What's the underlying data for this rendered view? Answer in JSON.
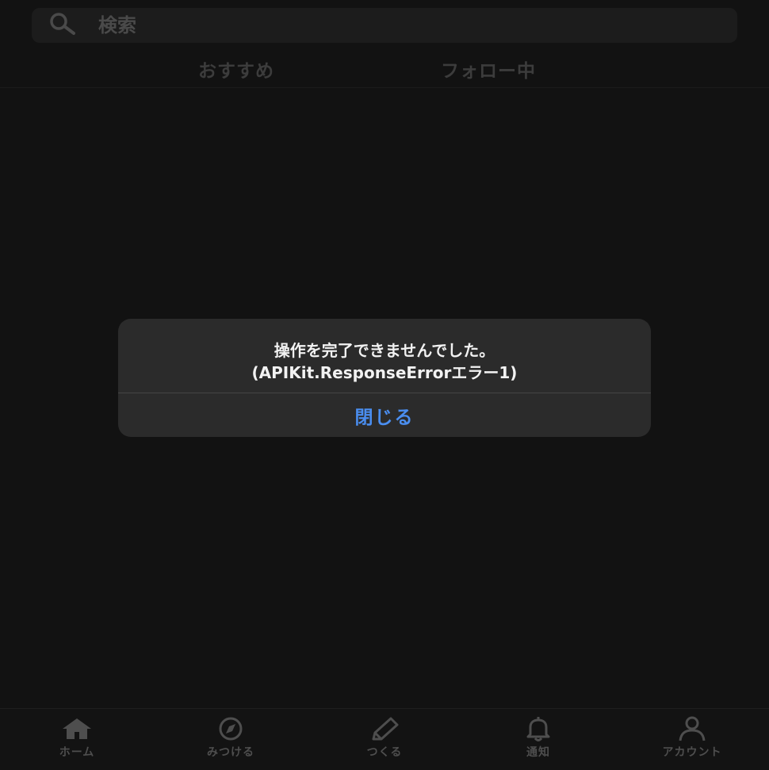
{
  "search": {
    "placeholder": "検索"
  },
  "tabs": [
    {
      "label": "おすすめ"
    },
    {
      "label": "フォロー中"
    }
  ],
  "alert": {
    "message_line1": "操作を完了できませんでした。",
    "message_line2": "(APIKit.ResponseErrorエラー1)",
    "close_label": "閉じる"
  },
  "bottom_nav": [
    {
      "label": "ホーム",
      "icon": "home-icon"
    },
    {
      "label": "みつける",
      "icon": "compass-icon"
    },
    {
      "label": "つくる",
      "icon": "pencil-icon"
    },
    {
      "label": "通知",
      "icon": "bell-icon"
    },
    {
      "label": "アカウント",
      "icon": "person-icon"
    }
  ],
  "colors": {
    "background": "#121212",
    "alert_background": "#2b2b2b",
    "accent": "#4a8ef0",
    "muted": "#4e4e4e"
  }
}
